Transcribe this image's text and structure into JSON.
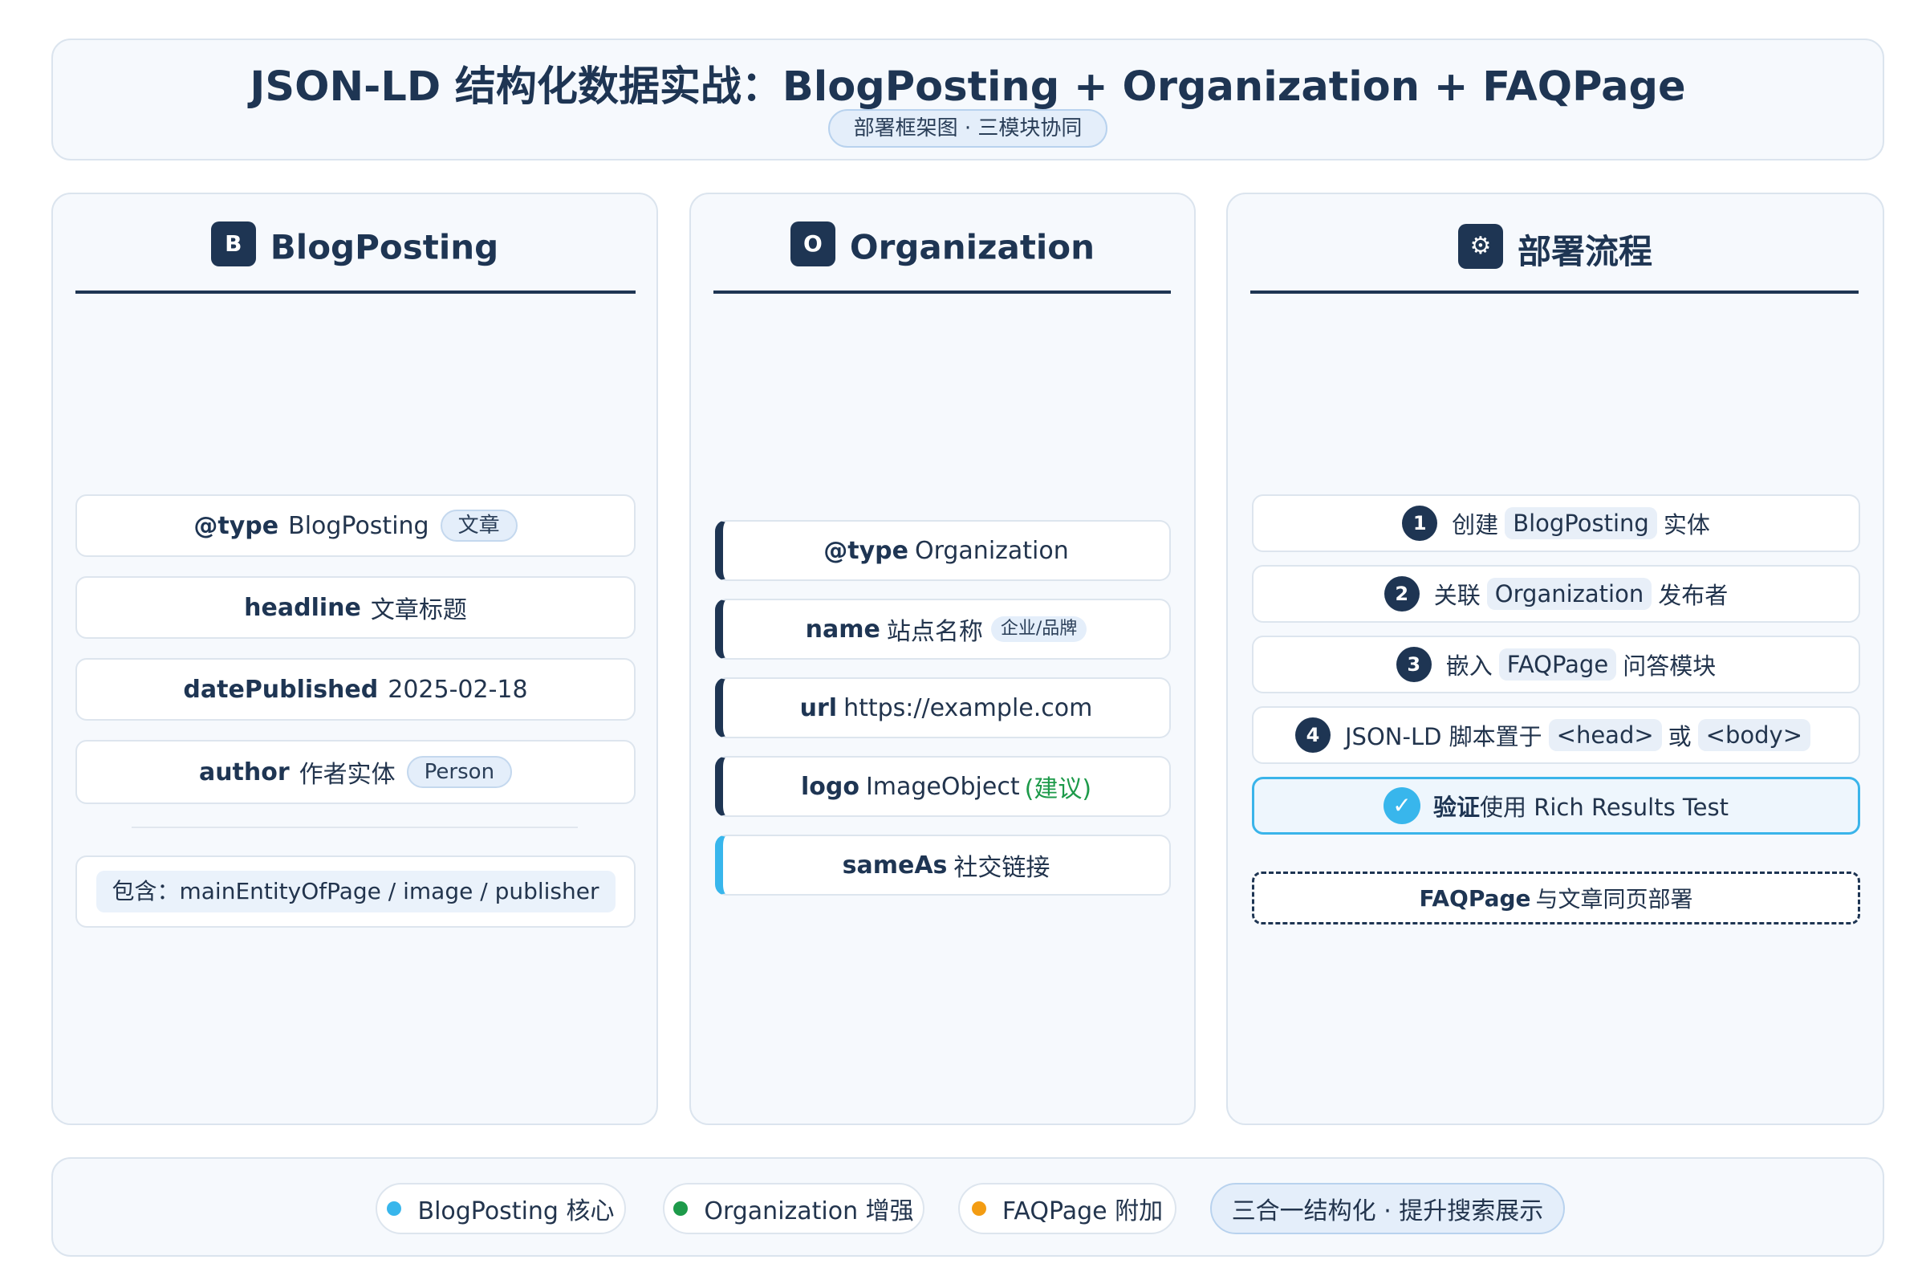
{
  "header": {
    "title": "JSON-LD 结构化数据实战：BlogPosting + Organization + FAQPage",
    "subtitle": "部署框架图 · 三模块协同"
  },
  "columns": {
    "blogposting": {
      "badge": "B",
      "title": "BlogPosting",
      "fields": [
        {
          "key": "@type",
          "value": "BlogPosting",
          "tag": "文章"
        },
        {
          "key": "headline",
          "value": "文章标题"
        },
        {
          "key": "datePublished",
          "value": "2025-02-18"
        },
        {
          "key": "author",
          "value": "作者实体",
          "tag": "Person"
        }
      ],
      "includes": "包含：mainEntityOfPage / image / publisher"
    },
    "organization": {
      "badge": "O",
      "title": "Organization",
      "fields": [
        {
          "key": "@type",
          "value": "Organization"
        },
        {
          "key": "name",
          "value": "站点名称",
          "tag": "企业/品牌"
        },
        {
          "key": "url",
          "value": "https://example.com"
        },
        {
          "key": "logo",
          "value": "ImageObject",
          "note": "(建议)"
        },
        {
          "key": "sameAs",
          "value": "社交链接"
        }
      ]
    },
    "deploy": {
      "badge_icon": "gear-icon",
      "badge": "⚙",
      "title": "部署流程",
      "steps": [
        {
          "num": "1",
          "pre": "创建",
          "code": "BlogPosting",
          "post": "实体"
        },
        {
          "num": "2",
          "pre": "关联",
          "code": "Organization",
          "post": "发布者"
        },
        {
          "num": "3",
          "pre": "嵌入",
          "code": "FAQPage",
          "post": "问答模块"
        },
        {
          "num": "4",
          "pre": "JSON-LD 脚本置于",
          "code": "<head>",
          "mid": "或",
          "code2": "<body>"
        }
      ],
      "verify": {
        "icon": "check-icon",
        "mark": "✓",
        "bold": "验证",
        "text": "使用 Rich Results Test"
      },
      "faq_note": {
        "bold": "FAQPage",
        "text": "与文章同页部署"
      }
    }
  },
  "footer": {
    "legend": [
      {
        "label": "BlogPosting 核心",
        "color": "#38b6ec"
      },
      {
        "label": "Organization 增强",
        "color": "#1d9a4a"
      },
      {
        "label": "FAQPage 附加",
        "color": "#f39c12"
      }
    ],
    "summary": "三合一结构化 · 提升搜索展示"
  }
}
